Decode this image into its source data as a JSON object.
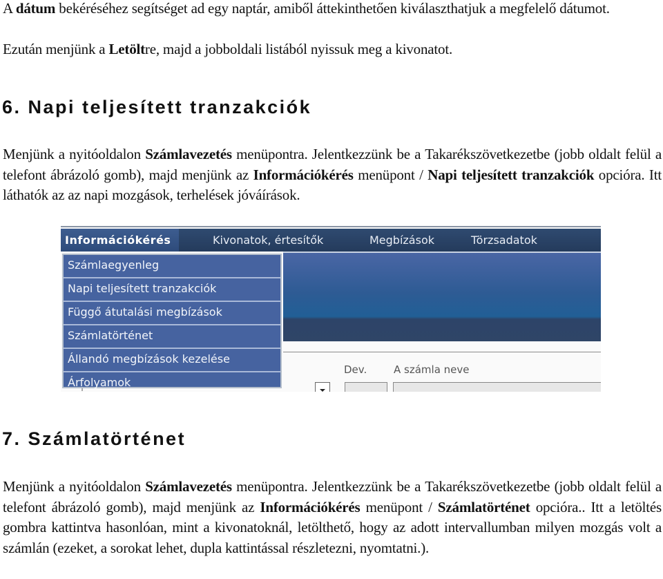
{
  "intro": {
    "line1_pre": "A ",
    "line1_bold": "dátum",
    "line1_post": " bekéréséhez segítséget ad egy naptár, amiből áttekinthetően kiválaszthatjuk a megfelelő dátumot.",
    "line2_pre": "Ezután menjünk a ",
    "line2_bold": "Letölt",
    "line2_post": "re, majd a jobboldali listából nyissuk meg a kivonatot."
  },
  "section6": {
    "heading": "6. Napi teljesített tranzakciók",
    "p1": "Menjünk a nyitóoldalon ",
    "b1": "Számlavezetés",
    "p2": " menüpontra. Jelentkezzünk be a Takarékszövetkezetbe (jobb oldalt felül a telefont ábrázoló gomb), majd menjünk az ",
    "b2": "Információkérés",
    "p3": " menüpont / ",
    "b3": "Napi teljesített tranzakciók",
    "p4": " opcióra. Itt láthatók az az napi mozgások, terhelések jóváírások."
  },
  "screenshot": {
    "nav": [
      {
        "label": "Információkérés",
        "active": true
      },
      {
        "label": "Kivonatok, értesítők",
        "active": false
      },
      {
        "label": "Megbízások",
        "active": false
      },
      {
        "label": "Törzsadatok",
        "active": false
      }
    ],
    "dropdown": [
      "Számlaegyenleg",
      "Napi teljesített tranzakciók",
      "Függő átutalási megbízások",
      "Számlatörténet",
      "Állandó megbízások kezelése",
      "Árfolyamok"
    ],
    "labels": {
      "currency": "Dev.",
      "account_name": "A számla neve"
    },
    "colors": {
      "nav_bg": "#243b5c",
      "dropdown_bg": "#4663a0",
      "band_blue": "#215f96"
    }
  },
  "section7": {
    "heading": "7. Számlatörténet",
    "p1": "Menjünk a nyitóoldalon ",
    "b1": "Számlavezetés",
    "p2": " menüpontra. Jelentkezzünk be a Takarékszövetkezetbe (jobb oldalt felül a telefont ábrázoló gomb), majd menjünk az ",
    "b2": "Információkérés",
    "p3": " menüpont / ",
    "b3": "Számlatörténet",
    "p4": " opcióra.. Itt a letöltés gombra kattintva hasonlóan, mint a kivonatoknál, letölthető, hogy az adott intervallumban milyen mozgás volt a számlán (ezeket, a sorokat lehet, dupla kattintással részletezni, nyomtatni.)."
  }
}
